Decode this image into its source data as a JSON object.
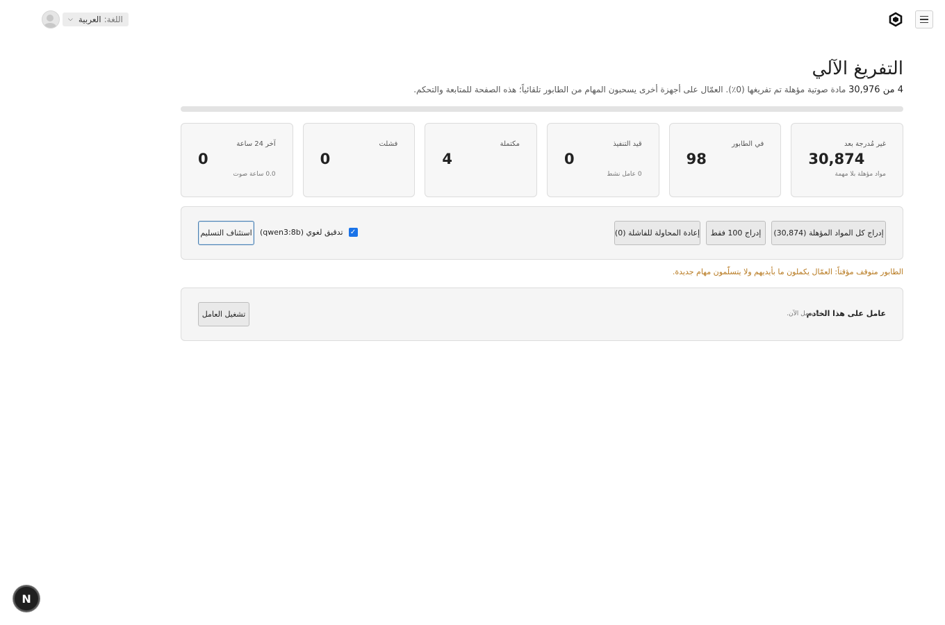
{
  "header": {
    "menu_icon": "hamburger-icon",
    "logo_icon": "hexagon-logo-icon",
    "language_label": "اللغة:",
    "language_value": "العربية",
    "avatar_icon": "user-avatar-icon"
  },
  "page": {
    "title": "التفريغ الآلي",
    "subtitle_count": "4 من 30,976",
    "subtitle_text": "مادة صوتية مؤهلة تم تفريغها (0٪). العمّال على أجهزة أخرى يسحبون المهام من الطابور تلقائياً؛ هذه الصفحة للمتابعة والتحكم.",
    "progress_fraction": 0.0001
  },
  "stats": [
    {
      "label": "غير مُدرجة بعد",
      "value": "30,874",
      "hint": "مواد مؤهلة بلا مهمة"
    },
    {
      "label": "في الطابور",
      "value": "98",
      "hint": ""
    },
    {
      "label": "قيد التنفيذ",
      "value": "0",
      "hint": "0 عامل نشط"
    },
    {
      "label": "مكتملة",
      "value": "4",
      "hint": ""
    },
    {
      "label": "فشلت",
      "value": "0",
      "hint": ""
    },
    {
      "label": "آخر 24 ساعة",
      "value": "0",
      "hint": "0.0 ساعة صوت"
    }
  ],
  "queue": {
    "enqueue_all": "إدراج كل المواد المؤهلة (30,874)",
    "enqueue_100": "إدراج 100 فقط",
    "retry_failed": "إعادة المحاولة للفاشلة (0)",
    "lint_label": "تدقيق لغوي (qwen3:8b)",
    "lint_checked": true,
    "resume": "استئناف التسليم"
  },
  "warning": "الطابور متوقف مؤقتاً: العمّال يكملون ما بأيديهم ولا يتسلّمون مهام جديدة.",
  "worker": {
    "title": "عامل على هذا الخادم",
    "status": "لا يعمل الآن.",
    "start": "تشغيل العامل"
  },
  "fab_label": "N"
}
